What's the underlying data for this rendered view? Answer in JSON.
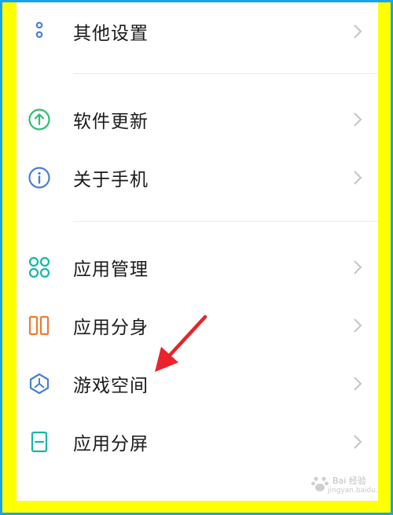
{
  "settings": {
    "items": [
      {
        "label": "其他设置",
        "icon": "dots-icon"
      },
      {
        "label": "软件更新",
        "icon": "upload-arrow-icon"
      },
      {
        "label": "关于手机",
        "icon": "info-icon"
      },
      {
        "label": "应用管理",
        "icon": "grid-icon"
      },
      {
        "label": "应用分身",
        "icon": "clone-icon"
      },
      {
        "label": "游戏空间",
        "icon": "game-icon"
      },
      {
        "label": "应用分屏",
        "icon": "split-screen-icon"
      }
    ]
  },
  "watermark": {
    "text": "Bai 经验",
    "sub": "jingyan.baidu.com"
  },
  "colors": {
    "frame_blue": "#1aa3e8",
    "frame_yellow": "#ffff00",
    "green": "#2fbf71",
    "info_blue": "#4a7fd0",
    "teal": "#19b6a6",
    "orange": "#f07a2b",
    "red_arrow": "#e8242a"
  }
}
